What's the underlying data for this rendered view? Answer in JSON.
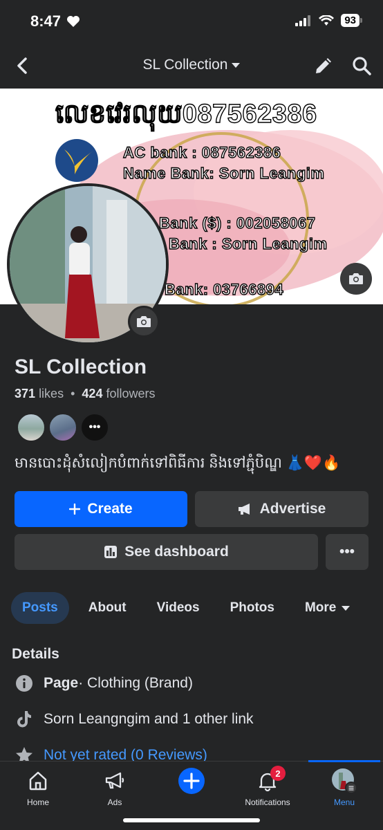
{
  "status": {
    "time": "8:47",
    "battery": "93"
  },
  "nav": {
    "title": "SL Collection"
  },
  "cover": {
    "line1": "លេខវេរលុយ087562386",
    "line2": "AC bank : 087562386",
    "line3": "Name Bank: Sorn Leangim",
    "line4": "Bank ($) : 002058067",
    "line5": "Bank : Sorn Leangim",
    "line6": "Bank: 03766894"
  },
  "page": {
    "name": "SL Collection",
    "likes_count": "371",
    "likes_label": "likes",
    "followers_count": "424",
    "followers_label": "followers",
    "separator": "•",
    "more_friends": "•••",
    "bio": "មានបោះដុំសំលៀកបំពាក់ទៅពិធីការ និងទៅភ្ជុំបិណ្ឌ 👗❤️‍🔥"
  },
  "actions": {
    "create": "Create",
    "advertise": "Advertise",
    "dashboard": "See dashboard",
    "more": "•••"
  },
  "tabs": [
    {
      "label": "Posts"
    },
    {
      "label": "About"
    },
    {
      "label": "Videos"
    },
    {
      "label": "Photos"
    },
    {
      "label": "More"
    }
  ],
  "details": {
    "title": "Details",
    "page_bold": "Page",
    "page_category": " · Clothing (Brand)",
    "links": "Sorn Leangngim and 1 other link",
    "rating": "Not yet rated (0 Reviews)"
  },
  "bottom_nav": {
    "home": "Home",
    "ads": "Ads",
    "notifications": "Notifications",
    "notifications_badge": "2",
    "menu": "Menu"
  },
  "colors": {
    "background": "#242526",
    "accent": "#0866ff",
    "link": "#4599ff",
    "button_secondary": "#3a3b3c",
    "badge": "#e41e3f"
  }
}
